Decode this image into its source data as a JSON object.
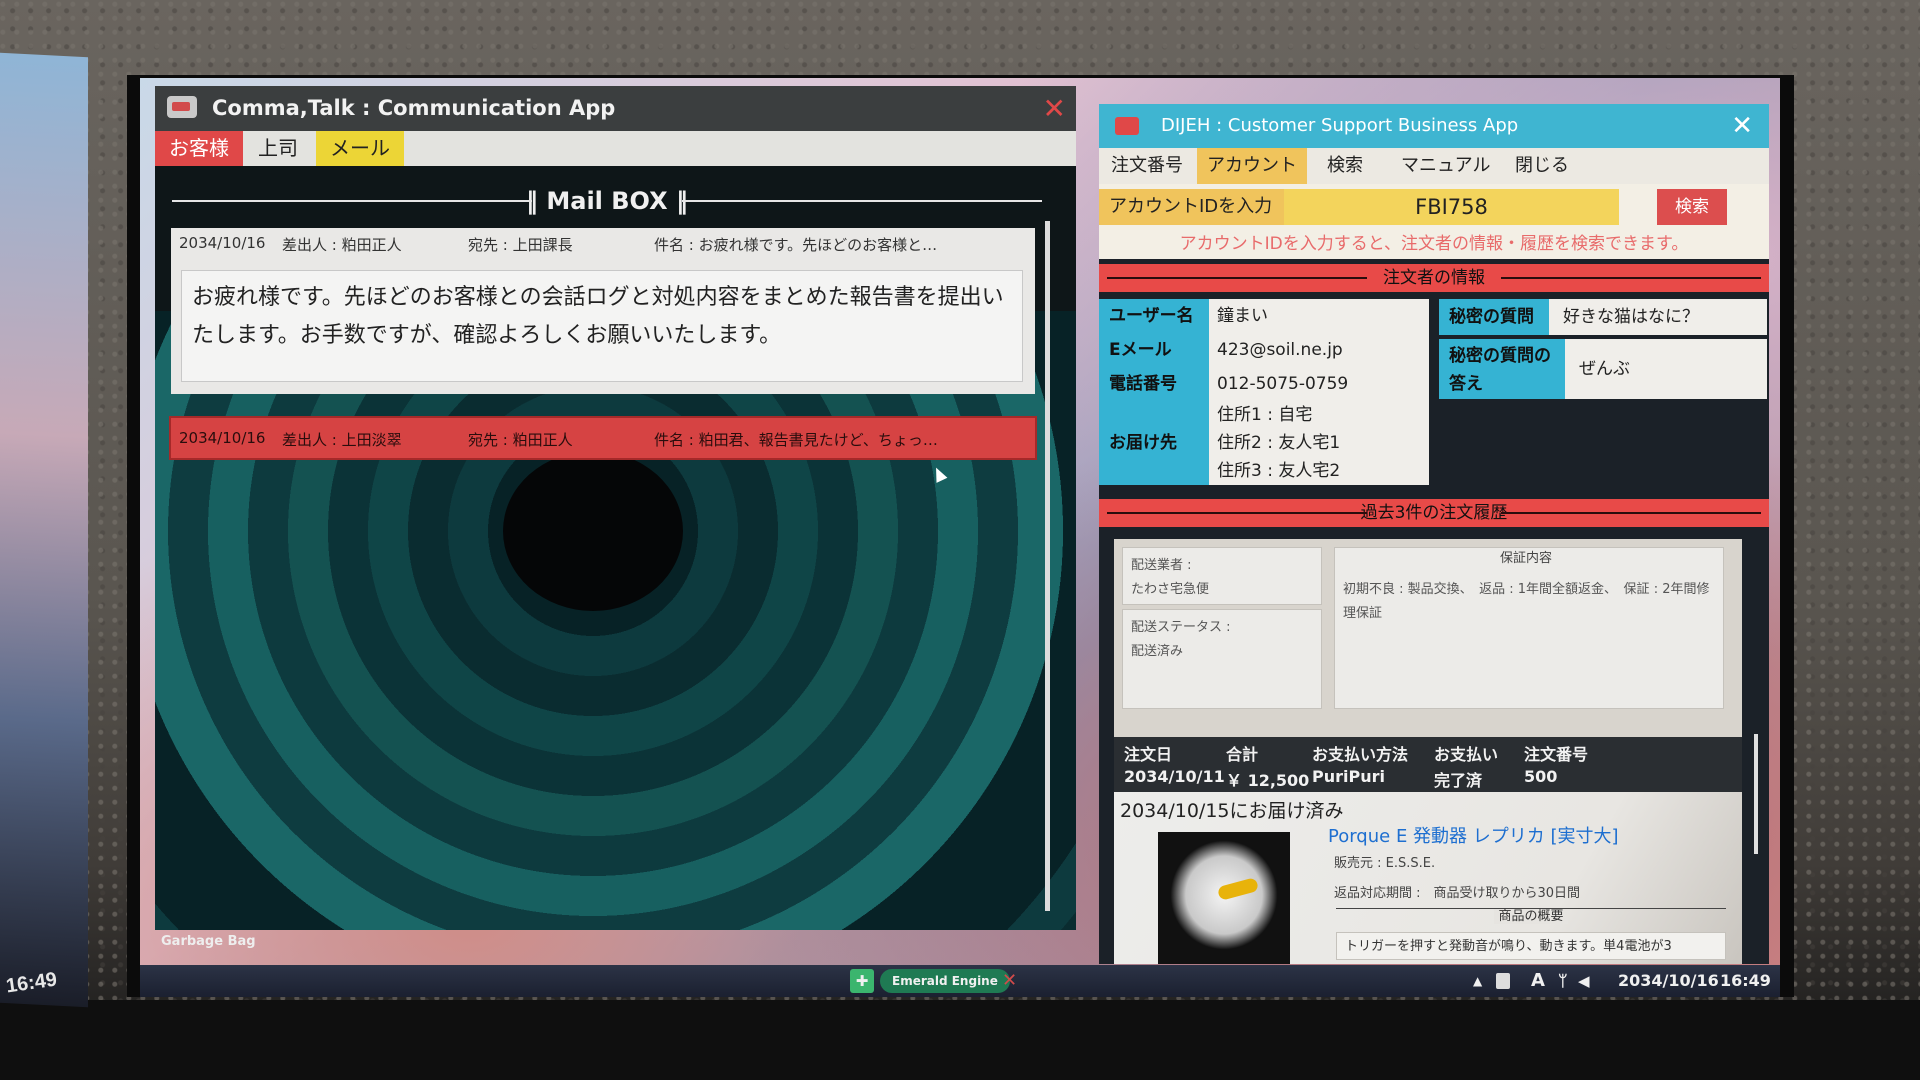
{
  "scene": {
    "left_clock": "16:49"
  },
  "comma_talk": {
    "title": "Comma,Talk : Communication App",
    "close_glyph": "✕",
    "tabs": [
      {
        "label": "お客様",
        "color": "#e04848"
      },
      {
        "label": "上司",
        "color": "#e3e3df"
      },
      {
        "label": "メール",
        "color": "#ecd536"
      }
    ],
    "mailbox_title": "‖ Mail BOX ‖",
    "mails": [
      {
        "date": "2034/10/16",
        "from": "差出人 : 粕田正人",
        "to": "宛先 : 上田課長",
        "subject": "件名 : お疲れ様です。先ほどのお客様と…",
        "body": "お疲れ様です。先ほどのお客様との会話ログと対処内容をまとめた報告書を提出いたします。お手数ですが、確認よろしくお願いいたします。"
      },
      {
        "date": "2034/10/16",
        "from": "差出人 : 上田淡翠",
        "to": "宛先 : 粕田正人",
        "subject": "件名 : 粕田君、報告書見たけど、ちょっ…"
      }
    ],
    "footer": "Garbage Bag"
  },
  "dijeh": {
    "title": "DIJEH : Customer Support Business App",
    "close_glyph": "✕",
    "menu": [
      "注文番号",
      "アカウント",
      "検索",
      "マニュアル",
      "閉じる"
    ],
    "active_menu_color": "#f0c45c",
    "search": {
      "label": "アカウントIDを入力",
      "value": "FBI758",
      "button": "検索",
      "hint": "アカウントIDを入力すると、注文者の情報・履歴を検索できます。"
    },
    "orderer_section": "注文者の情報",
    "orderer": {
      "user_label": "ユーザー名",
      "user_value": "鐘まい",
      "email_label": "Eメール",
      "email_value": "423@soil.ne.jp",
      "phone_label": "電話番号",
      "phone_value": "012-5075-0759",
      "address_label": "お届け先",
      "addresses": [
        "住所1 : 自宅",
        "住所2 : 友人宅1",
        "住所3 : 友人宅2"
      ],
      "secret_q_label": "秘密の質問",
      "secret_q_value": "好きな猫はなに？",
      "secret_a_label": "秘密の質問の答え",
      "secret_a_value": "ぜんぶ"
    },
    "history_section": "過去3件の注文履歴",
    "history": {
      "carrier_label": "配送業者 :",
      "carrier_value": "たわさ宅急便",
      "status_label": "配送ステータス :",
      "status_value": "配送済み",
      "warranty_title": "保証内容",
      "warranty_text": "初期不良 : 製品交換、　返品 : 1年間全額返金、　保証 : 2年間修理保証",
      "order_headers": [
        "注文日",
        "合計",
        "お支払い方法",
        "お支払い",
        "注文番号"
      ],
      "order_values": [
        "2034/10/11",
        "￥ 12,500",
        "PuriPuri",
        "完了済",
        "500"
      ],
      "delivered": "2034/10/15にお届け済み",
      "product_name": "Porque E 発動器 レプリカ [実寸大]",
      "seller": "販売元 : E.S.S.E.",
      "return_period": "返品対応期間 :　商品受け取りから30日間",
      "summary_title": "商品の概要",
      "summary_text": "トリガーを押すと発動音が鳴り、動きます。単4電池が3"
    }
  },
  "taskbar": {
    "app_label": "Emerald Engine",
    "ime": "A",
    "date": "2034/10/16",
    "time": "16:49",
    "tray_up": "▲"
  }
}
